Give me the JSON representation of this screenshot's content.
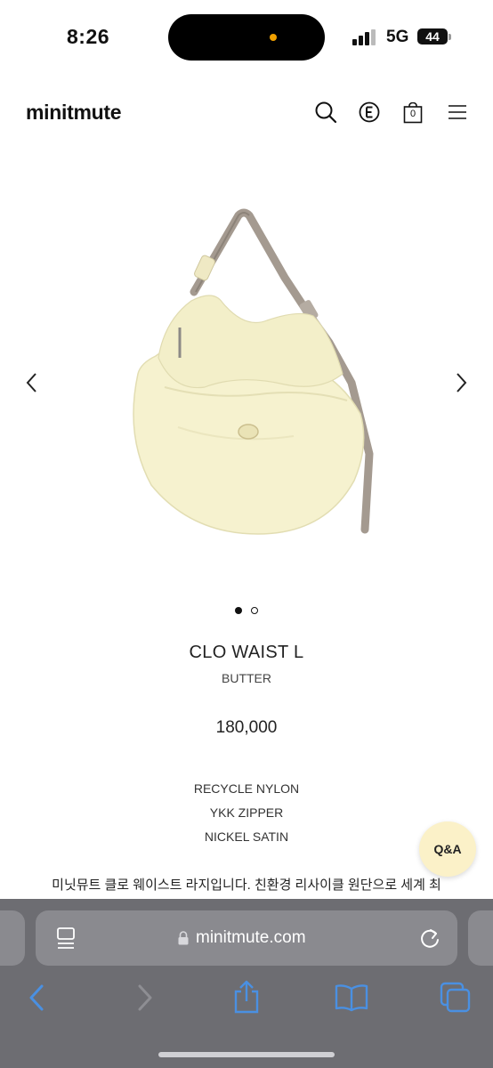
{
  "status_bar": {
    "time": "8:26",
    "network": "5G",
    "battery": "44"
  },
  "header": {
    "logo": "minitmute",
    "cart_count": "0",
    "brand_icon_letter": "E"
  },
  "product": {
    "name": "CLO WAIST L",
    "color": "BUTTER",
    "price": "180,000",
    "materials": [
      "RECYCLE NYLON",
      "YKK ZIPPER",
      "NICKEL SATIN"
    ],
    "description": "미닛뮤트 클로 웨이스트 라지입니다. 친환경 리사이클 원단으로 세계 최",
    "image_count": 2,
    "active_image": 1
  },
  "qa_button": {
    "label": "Q&A"
  },
  "browser": {
    "url": "minitmute.com"
  },
  "colors": {
    "bag": "#f6f2cf",
    "strap": "#a49a90",
    "toolbar": "#6d6d72",
    "link_blue": "#4a90e2",
    "qa_bg": "#fbf1c8"
  }
}
